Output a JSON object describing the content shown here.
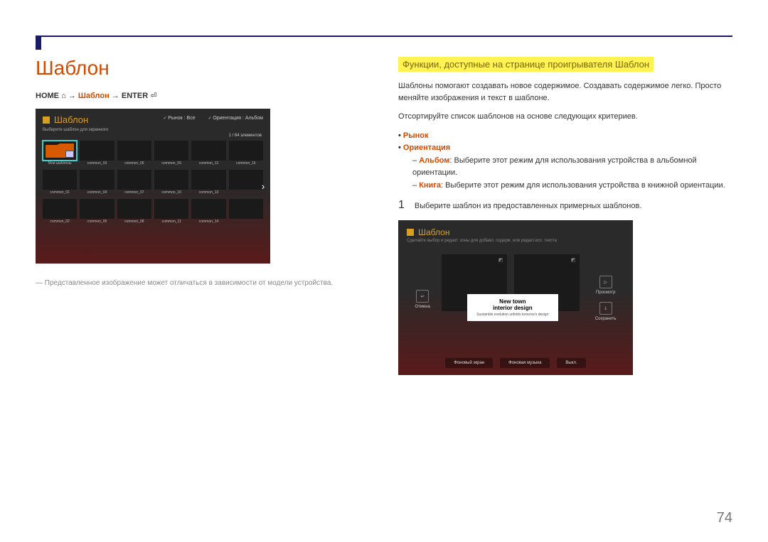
{
  "page": {
    "title": "Шаблон",
    "page_number": "74"
  },
  "breadcrumb": {
    "home": "HOME",
    "template": "Шаблон",
    "enter": "ENTER",
    "arrow": "→"
  },
  "footnote": "―  Представленное изображение может отличаться в зависимости от модели устройства.",
  "shot1": {
    "title": "Шаблон",
    "subtitle": "Выберите шаблон для экранного",
    "filter_market": "Рынок : Все",
    "filter_orient": "Ориентация : Альбом",
    "count": "1 / 64 элементов",
    "labels": [
      "Мои шаблоны",
      "common_03",
      "common_06",
      "common_09",
      "common_12",
      "common_15",
      "common_01",
      "common_04",
      "common_07",
      "common_10",
      "common_13",
      "",
      "common_02",
      "common_05",
      "common_08",
      "common_11",
      "common_14",
      ""
    ]
  },
  "right": {
    "heading": "Функции, доступные на странице проигрывателя Шаблон",
    "p1": "Шаблоны помогают создавать новое содержимое. Создавать содержимое легко. Просто меняйте изображения и текст в шаблоне.",
    "p2": "Отсортируйте список шаблонов на основе следующих критериев.",
    "li_market": "Рынок",
    "li_orient": "Ориентация",
    "li_album_k": "Альбом",
    "li_album_v": ": Выберите этот режим для использования устройства в альбомной ориентации.",
    "li_book_k": "Книга",
    "li_book_v": ": Выберите этот режим для использования устройства в книжной ориентации.",
    "step1_num": "1",
    "step1_text": "Выберите шаблон из предоставленных примерных шаблонов."
  },
  "shot2": {
    "title": "Шаблон",
    "subtitle": "Сделайте выбор и редакт. зоны для добавл. содерж. или редакт.исх. текста",
    "cancel": "Отмена",
    "preview": "Просмотр",
    "save": "Сохранить",
    "card_t1": "New town",
    "card_t2": "interior design",
    "card_t3": "Sustainble evolution unfolds tomorrw's design",
    "btn_bg": "Фоновый экран",
    "btn_music": "Фоновая музыка",
    "btn_exit": "Выкл."
  }
}
